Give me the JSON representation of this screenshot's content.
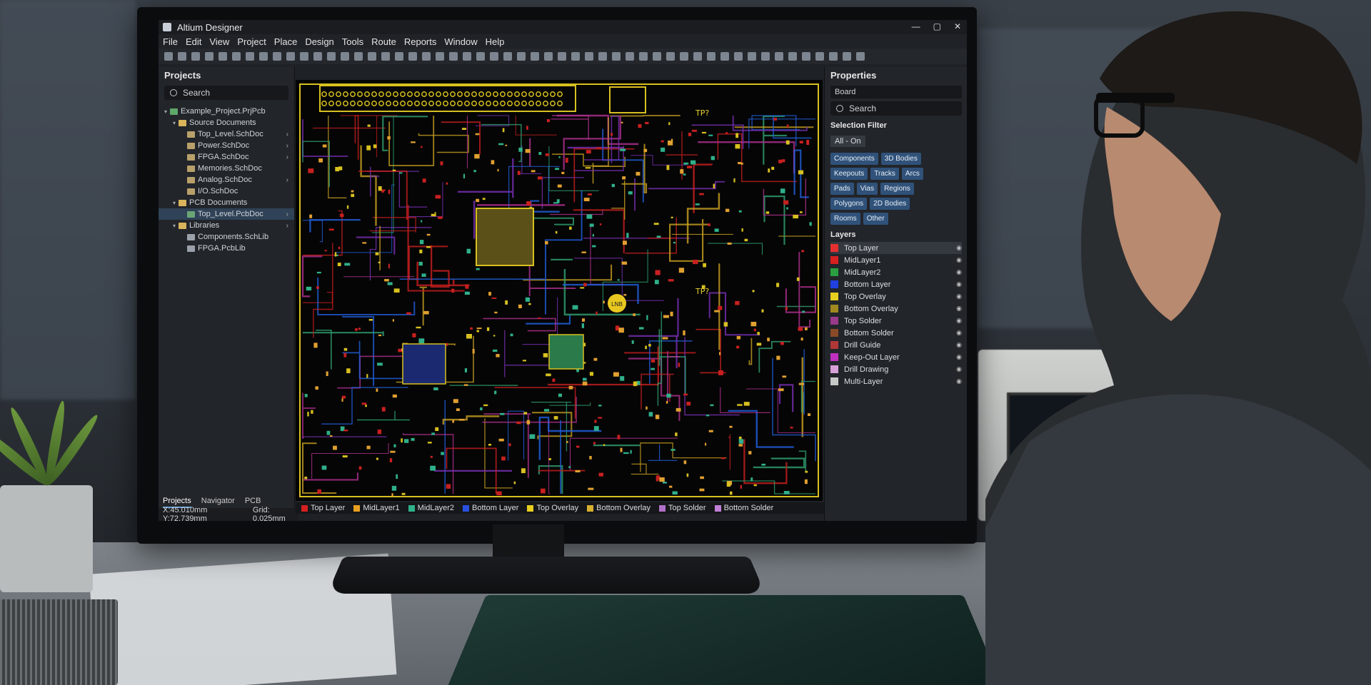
{
  "window": {
    "title": "Altium Designer",
    "controls": [
      "—",
      "▢",
      "✕"
    ]
  },
  "menu": [
    "File",
    "Edit",
    "View",
    "Project",
    "Place",
    "Design",
    "Tools",
    "Route",
    "Reports",
    "Window",
    "Help"
  ],
  "projects_panel": {
    "title": "Projects",
    "search_placeholder": "Search",
    "tree": [
      {
        "label": "Example_Project.PrjPcb",
        "level": 0,
        "icon": "project-icon",
        "twisty": "▾"
      },
      {
        "label": "Source Documents",
        "level": 1,
        "icon": "folder-icon",
        "twisty": "▾"
      },
      {
        "label": "Top_Level.SchDoc",
        "level": 2,
        "icon": "schematic-icon",
        "chev": "›"
      },
      {
        "label": "Power.SchDoc",
        "level": 2,
        "icon": "schematic-icon",
        "chev": "›"
      },
      {
        "label": "FPGA.SchDoc",
        "level": 2,
        "icon": "schematic-icon",
        "chev": "›"
      },
      {
        "label": "Memories.SchDoc",
        "level": 2,
        "icon": "schematic-icon",
        "chev": ""
      },
      {
        "label": "Analog.SchDoc",
        "level": 2,
        "icon": "schematic-icon",
        "chev": "›"
      },
      {
        "label": "I/O.SchDoc",
        "level": 2,
        "icon": "schematic-icon",
        "chev": ""
      },
      {
        "label": "PCB Documents",
        "level": 1,
        "icon": "folder-icon",
        "twisty": "▾"
      },
      {
        "label": "Top_Level.PcbDoc",
        "level": 2,
        "icon": "pcb-icon",
        "chev": "›",
        "selected": true
      },
      {
        "label": "Libraries",
        "level": 1,
        "icon": "folder-icon",
        "twisty": "▾",
        "chev": "›"
      },
      {
        "label": "Components.SchLib",
        "level": 2,
        "icon": "library-icon"
      },
      {
        "label": "FPGA.PcbLib",
        "level": 2,
        "icon": "library-icon"
      }
    ],
    "tabs": [
      "Projects",
      "Navigator",
      "PCB"
    ]
  },
  "status": {
    "coords": "X:45.010mm Y:72.739mm",
    "grid": "Grid: 0.025mm"
  },
  "canvas_labels": {
    "tp1": "TP?",
    "tp2": "TP?",
    "led": "LNB"
  },
  "layer_tabs": [
    {
      "label": "Top Layer",
      "color": "#d42020"
    },
    {
      "label": "MidLayer1",
      "color": "#e8a020"
    },
    {
      "label": "MidLayer2",
      "color": "#2fb08a"
    },
    {
      "label": "Bottom Layer",
      "color": "#2a50e0"
    },
    {
      "label": "Top Overlay",
      "color": "#e8d020"
    },
    {
      "label": "Bottom Overlay",
      "color": "#d8b030"
    },
    {
      "label": "Top Solder",
      "color": "#b070c8"
    },
    {
      "label": "Bottom Solder",
      "color": "#c080d8"
    }
  ],
  "properties": {
    "title": "Properties",
    "dropdown": "Board",
    "search_placeholder": "Search",
    "selection_filter_label": "Selection Filter",
    "all_on": "All - On",
    "filters": [
      "Components",
      "3D Bodies",
      "Keepouts",
      "Tracks",
      "Arcs",
      "Pads",
      "Vias",
      "Regions",
      "Polygons",
      "2D Bodies",
      "Rooms",
      "Other"
    ],
    "layers_label": "Layers",
    "layers": [
      {
        "name": "Top Layer",
        "color": "#e53030",
        "selected": true
      },
      {
        "name": "MidLayer1",
        "color": "#d82020"
      },
      {
        "name": "MidLayer2",
        "color": "#2aa040"
      },
      {
        "name": "Bottom Layer",
        "color": "#2040e0"
      },
      {
        "name": "Top Overlay",
        "color": "#e8d020"
      },
      {
        "name": "Bottom Overlay",
        "color": "#a08a20"
      },
      {
        "name": "Top Solder",
        "color": "#9a3a8a"
      },
      {
        "name": "Bottom Solder",
        "color": "#8a4a28"
      },
      {
        "name": "Drill Guide",
        "color": "#b03838"
      },
      {
        "name": "Keep-Out Layer",
        "color": "#c030c0"
      },
      {
        "name": "Drill Drawing",
        "color": "#d8a0d8"
      },
      {
        "name": "Multi-Layer",
        "color": "#c8c8c8"
      }
    ]
  }
}
